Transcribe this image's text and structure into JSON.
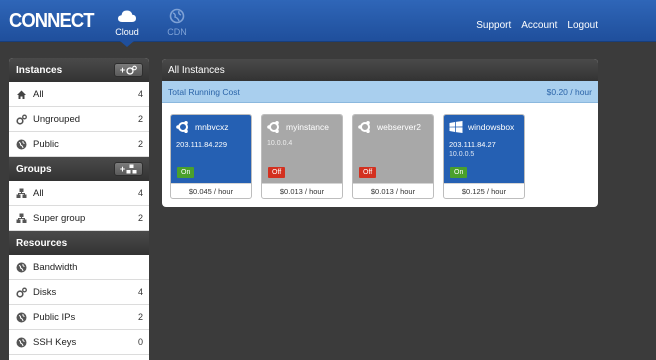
{
  "header": {
    "logo": "CONNECT",
    "tabs": [
      {
        "label": "Cloud",
        "icon": "cloud-icon",
        "active": true
      },
      {
        "label": "CDN",
        "icon": "globe-icon",
        "active": false
      }
    ],
    "links": [
      "Support",
      "Account",
      "Logout"
    ]
  },
  "sidebar": {
    "instances": {
      "title": "Instances",
      "items": [
        {
          "label": "All",
          "count": "4",
          "icon": "home-icon"
        },
        {
          "label": "Ungrouped",
          "count": "2",
          "icon": "gears-icon"
        },
        {
          "label": "Public",
          "count": "2",
          "icon": "globe-icon"
        }
      ]
    },
    "groups": {
      "title": "Groups",
      "items": [
        {
          "label": "All",
          "count": "4",
          "icon": "group-icon"
        },
        {
          "label": "Super group",
          "count": "2",
          "icon": "group-icon"
        }
      ]
    },
    "resources": {
      "title": "Resources",
      "items": [
        {
          "label": "Bandwidth",
          "count": "",
          "icon": "globe-icon"
        },
        {
          "label": "Disks",
          "count": "4",
          "icon": "gears-icon"
        },
        {
          "label": "Public IPs",
          "count": "2",
          "icon": "globe-icon"
        },
        {
          "label": "SSH Keys",
          "count": "0",
          "icon": "globe-icon"
        }
      ]
    }
  },
  "main": {
    "title": "All Instances",
    "cost_label": "Total Running Cost",
    "cost_value": "$0.20 / hour",
    "instances": [
      {
        "name": "mnbvcxz",
        "ip_public": "203.111.84.229",
        "ip_private": "",
        "status": "On",
        "price": "$0.045 / hour",
        "os_icon": "ubuntu-icon",
        "theme": "blue"
      },
      {
        "name": "myinstance",
        "ip_public": "",
        "ip_private": "10.0.0.4",
        "status": "Off",
        "price": "$0.013 / hour",
        "os_icon": "ubuntu-icon",
        "theme": "grey"
      },
      {
        "name": "webserver2",
        "ip_public": "",
        "ip_private": "",
        "status": "Off",
        "price": "$0.013 / hour",
        "os_icon": "ubuntu-icon",
        "theme": "grey"
      },
      {
        "name": "windowsbox",
        "ip_public": "203.111.84.27",
        "ip_private": "10.0.0.5",
        "status": "On",
        "price": "$0.125 / hour",
        "os_icon": "windows-icon",
        "theme": "blue"
      }
    ]
  },
  "colors": {
    "topbar": "#2f66b8",
    "card_on": "#2560b3",
    "card_off": "#a8a8a8",
    "badge_on": "#4aa02c",
    "badge_off": "#d3301f",
    "cost_bar": "#a9cfee"
  }
}
